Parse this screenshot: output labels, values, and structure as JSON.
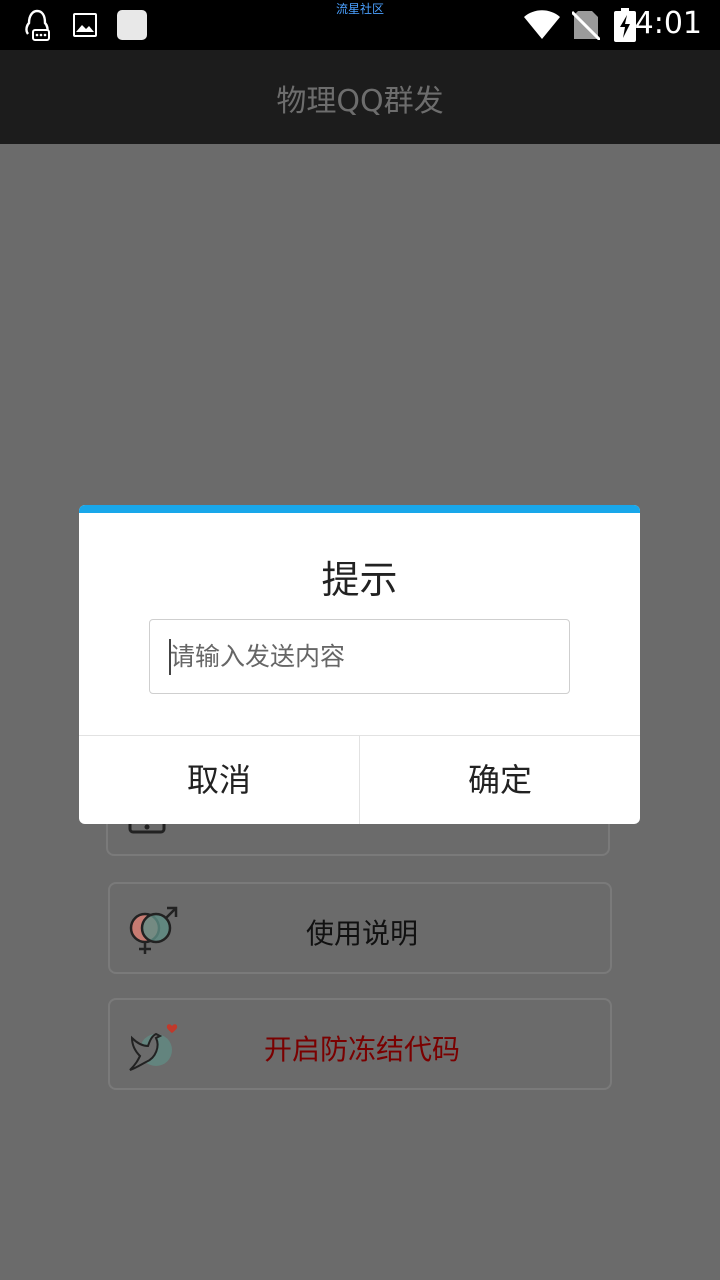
{
  "status_bar": {
    "time": "4:01",
    "watermark": "流星社区",
    "icons": [
      "qq-notification-icon",
      "image-notification-icon",
      "app-notification-icon",
      "wifi-icon",
      "no-sim-icon",
      "battery-charging-icon"
    ]
  },
  "app": {
    "title": "物理QQ群发"
  },
  "cards": [
    {
      "label": "使用说明",
      "icon": "gender-symbol-icon"
    },
    {
      "label": "开启防冻结代码",
      "icon": "dove-heart-icon",
      "color": "#7a0000"
    }
  ],
  "dialog": {
    "title": "提示",
    "input": {
      "value": "",
      "placeholder": "请输入发送内容"
    },
    "cancel_label": "取消",
    "ok_label": "确定",
    "accent_color": "#18a7ea"
  }
}
